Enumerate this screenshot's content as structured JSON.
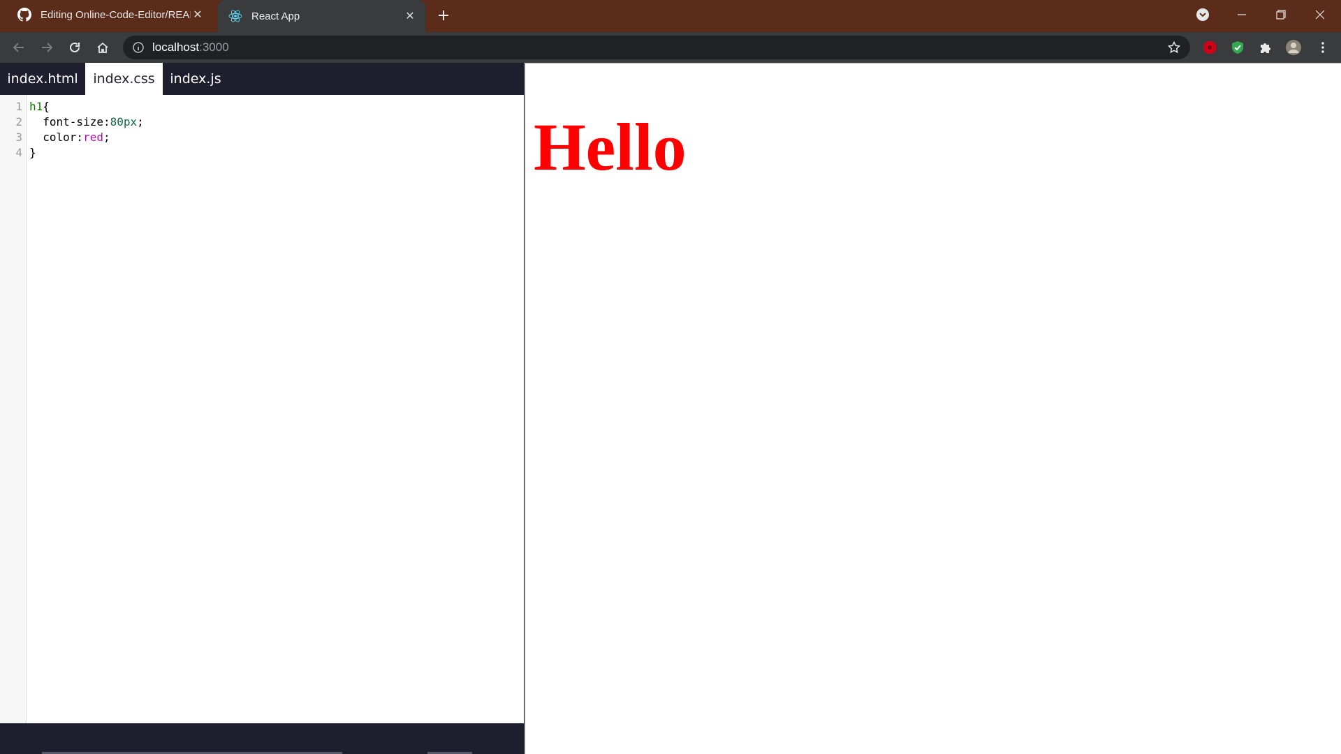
{
  "browser": {
    "tabs": [
      {
        "title": "Editing Online-Code-Editor/REAI",
        "icon": "github-icon",
        "active": false
      },
      {
        "title": "React App",
        "icon": "react-icon",
        "active": true
      }
    ],
    "url_host": "localhost",
    "url_port": ":3000"
  },
  "editor": {
    "tabs": [
      {
        "label": "index.html",
        "active": false
      },
      {
        "label": "index.css",
        "active": true
      },
      {
        "label": "index.js",
        "active": false
      }
    ],
    "line_numbers": [
      "1",
      "2",
      "3",
      "4"
    ],
    "code": {
      "l1_selector": "h1",
      "l1_brace": "{",
      "l2_prop": "  font-size:",
      "l2_value": "80px",
      "l2_end": ";",
      "l3_prop": "  color:",
      "l3_value": "red",
      "l3_end": ";",
      "l4_brace": "}"
    }
  },
  "preview": {
    "heading": "Hello"
  },
  "colors": {
    "titlebar": "#5b2c1a",
    "toolbar": "#3a3b3d",
    "editor_bar": "#1e1e2e",
    "heading": "#ff0000"
  }
}
